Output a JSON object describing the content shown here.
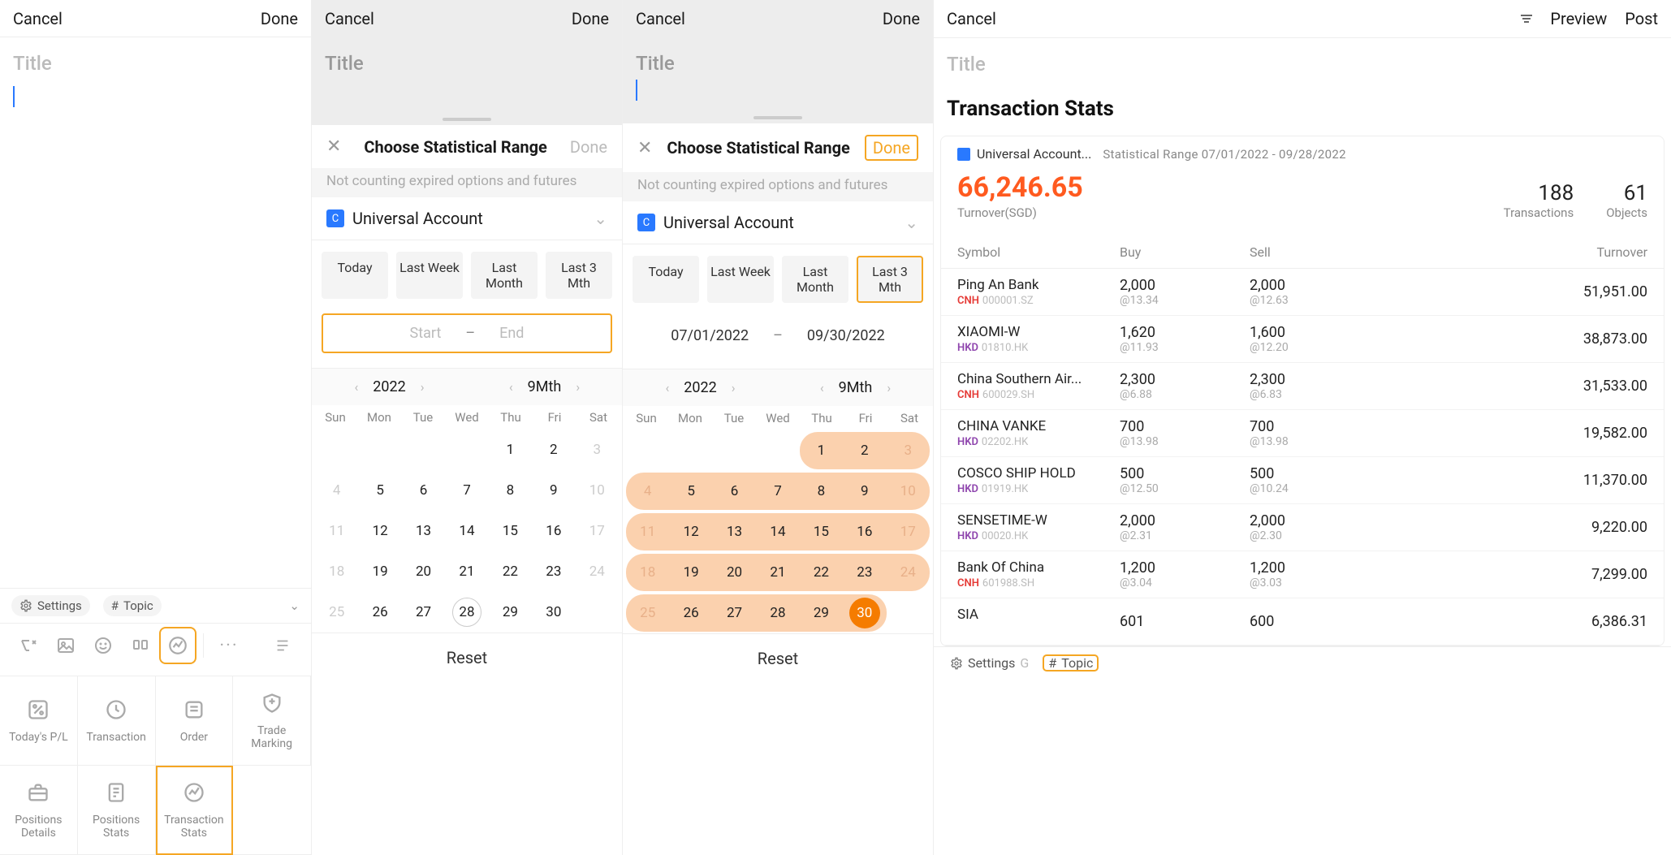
{
  "common": {
    "cancel": "Cancel",
    "done": "Done",
    "title_ph": "Title",
    "reset": "Reset",
    "preview": "Preview",
    "post": "Post",
    "settings_label": "Settings",
    "topic_label": "Topic"
  },
  "stat_panel": {
    "title": "Choose Statistical Range",
    "note": "Not counting expired options and futures",
    "account": "Universal Account",
    "presets": [
      "Today",
      "Last Week",
      "Last Month",
      "Last 3 Mth"
    ],
    "start_ph": "Start",
    "end_ph": "End",
    "start_val": "07/01/2022",
    "end_val": "09/30/2022",
    "year": "2022",
    "month": "9Mth",
    "dow": [
      "Sun",
      "Mon",
      "Tue",
      "Wed",
      "Thu",
      "Fri",
      "Sat"
    ]
  },
  "calendar": {
    "weeks": [
      [
        "",
        "",
        "",
        "",
        "1",
        "2",
        "3"
      ],
      [
        "4",
        "5",
        "6",
        "7",
        "8",
        "9",
        "10"
      ],
      [
        "11",
        "12",
        "13",
        "14",
        "15",
        "16",
        "17"
      ],
      [
        "18",
        "19",
        "20",
        "21",
        "22",
        "23",
        "24"
      ],
      [
        "25",
        "26",
        "27",
        "28",
        "29",
        "30",
        ""
      ]
    ],
    "dim_days": [
      "3",
      "10",
      "17",
      "24"
    ],
    "left_col_dim": [
      "4",
      "11",
      "18",
      "25"
    ],
    "today": "28"
  },
  "editor_tiles": {
    "row1": [
      "Today's P/L",
      "Transaction",
      "Order",
      "Trade Marking"
    ],
    "row2": [
      "Positions Details",
      "Positions Stats",
      "Transaction Stats"
    ]
  },
  "stats": {
    "heading": "Transaction Stats",
    "account_short": "Universal Account...",
    "range_label": "Statistical Range 07/01/2022 - 09/28/2022",
    "turnover": "66,246.65",
    "turnover_lbl": "Turnover(SGD)",
    "transactions": "188",
    "transactions_lbl": "Transactions",
    "objects": "61",
    "objects_lbl": "Objects",
    "cols": {
      "symbol": "Symbol",
      "buy": "Buy",
      "sell": "Sell",
      "turnover": "Turnover"
    },
    "rows": [
      {
        "name": "Ping An Bank",
        "cur": "CNH",
        "sid": "000001.SZ",
        "buy_q": "2,000",
        "buy_p": "@13.34",
        "sell_q": "2,000",
        "sell_p": "@12.63",
        "turn": "51,951.00"
      },
      {
        "name": "XIAOMI-W",
        "cur": "HKD",
        "sid": "01810.HK",
        "buy_q": "1,620",
        "buy_p": "@11.93",
        "sell_q": "1,600",
        "sell_p": "@12.20",
        "turn": "38,873.00"
      },
      {
        "name": "China Southern Air...",
        "cur": "CNH",
        "sid": "600029.SH",
        "buy_q": "2,300",
        "buy_p": "@6.88",
        "sell_q": "2,300",
        "sell_p": "@6.83",
        "turn": "31,533.00"
      },
      {
        "name": "CHINA VANKE",
        "cur": "HKD",
        "sid": "02202.HK",
        "buy_q": "700",
        "buy_p": "@13.98",
        "sell_q": "700",
        "sell_p": "@13.98",
        "turn": "19,582.00"
      },
      {
        "name": "COSCO SHIP HOLD",
        "cur": "HKD",
        "sid": "01919.HK",
        "buy_q": "500",
        "buy_p": "@12.50",
        "sell_q": "500",
        "sell_p": "@10.24",
        "turn": "11,370.00"
      },
      {
        "name": "SENSETIME-W",
        "cur": "HKD",
        "sid": "00020.HK",
        "buy_q": "2,000",
        "buy_p": "@2.31",
        "sell_q": "2,000",
        "sell_p": "@2.30",
        "turn": "9,220.00"
      },
      {
        "name": "Bank Of China",
        "cur": "CNH",
        "sid": "601988.SH",
        "buy_q": "1,200",
        "buy_p": "@3.04",
        "sell_q": "1,200",
        "sell_p": "@3.03",
        "turn": "7,299.00"
      },
      {
        "name": "SIA",
        "cur": "",
        "sid": "",
        "buy_q": "601",
        "buy_p": "",
        "sell_q": "600",
        "sell_p": "",
        "turn": "6,386.31"
      }
    ]
  }
}
